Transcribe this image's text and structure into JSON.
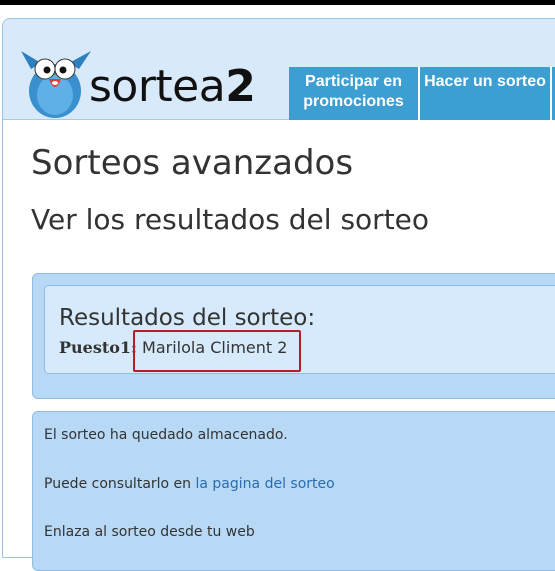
{
  "brand": {
    "name_part": "sortea",
    "name_digit": "2"
  },
  "nav": {
    "items": [
      {
        "label": "Participar en promociones"
      },
      {
        "label": "Hacer un sorteo"
      },
      {
        "label": ""
      }
    ]
  },
  "page": {
    "title": "Sorteos avanzados",
    "subtitle": "Ver los resultados del sorteo"
  },
  "results": {
    "heading": "Resultados del sorteo:",
    "rows": [
      {
        "label": "Puesto1:",
        "value": "Marilola Climent 2"
      }
    ]
  },
  "info": {
    "saved_text": "El sorteo ha quedado almacenado.",
    "consult_text": "Puede consultarlo en",
    "consult_link": "la pagina del sorteo",
    "embed_text": "Enlaza al sorteo desde tu web"
  },
  "colors": {
    "nav_bg": "#3d9ed2",
    "header_bg": "#d8e9fa",
    "panel_bg": "#b8d9f5",
    "highlight": "#b0202a",
    "link": "#2a6cb0"
  }
}
